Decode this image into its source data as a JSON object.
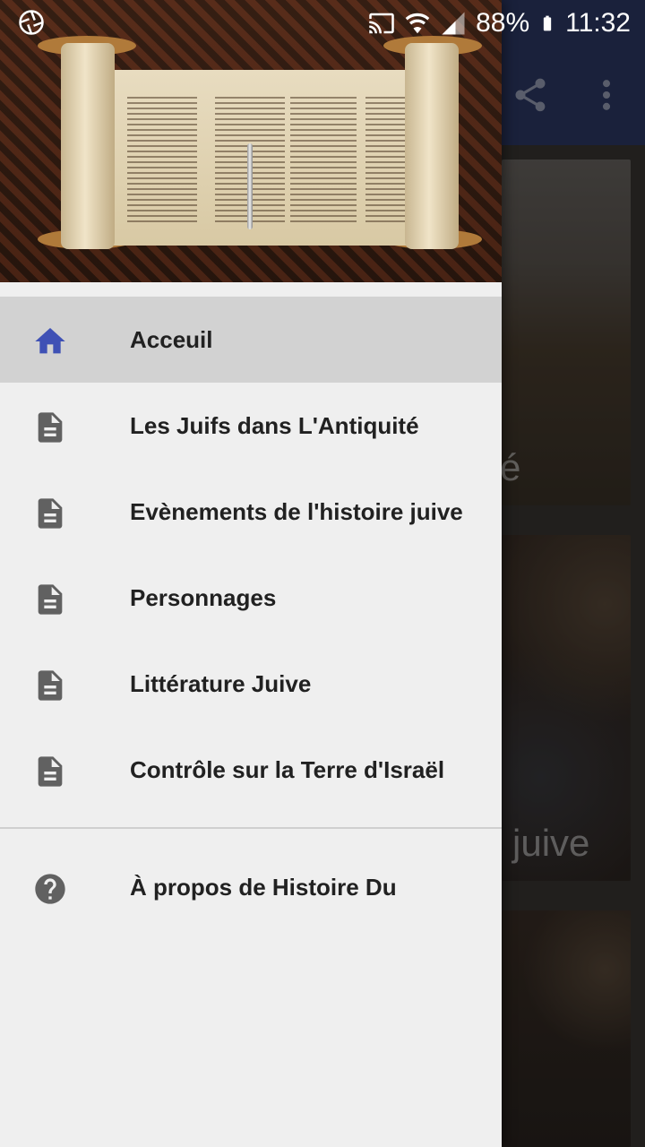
{
  "status_bar": {
    "battery_percent": "88%",
    "time": "11:32"
  },
  "background_app": {
    "cards": [
      {
        "label_fragment": "é"
      },
      {
        "label_fragment": "juive"
      },
      {
        "label_fragment": ""
      }
    ]
  },
  "drawer": {
    "items": [
      {
        "label": "Acceuil",
        "icon": "home-icon",
        "active": true
      },
      {
        "label": "Les Juifs dans L'Antiquité",
        "icon": "document-icon",
        "active": false
      },
      {
        "label": "Evènements de l'histoire juive",
        "icon": "document-icon",
        "active": false
      },
      {
        "label": "Personnages",
        "icon": "document-icon",
        "active": false
      },
      {
        "label": "Littérature Juive",
        "icon": "document-icon",
        "active": false
      },
      {
        "label": "Contrôle sur la Terre d'Israël",
        "icon": "document-icon",
        "active": false
      }
    ],
    "about": {
      "label": "À propos de Histoire Du",
      "icon": "help-icon"
    }
  },
  "colors": {
    "accent": "#3f51b5",
    "icon_gray": "#616161",
    "active_bg": "#d2d2d2",
    "drawer_bg": "#efefef",
    "toolbar": "#2d3a66"
  }
}
